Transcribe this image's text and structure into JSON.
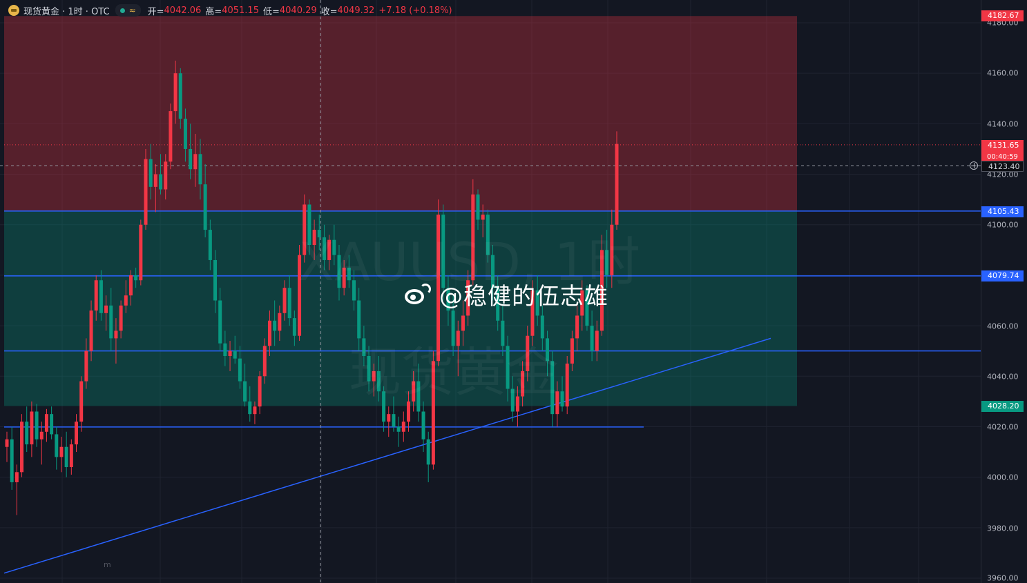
{
  "legend": {
    "title": "现货黄金 · 1时 · OTC",
    "wave_icon": "≈",
    "open_label": "开=",
    "open_value": "4042.06",
    "high_label": "高=",
    "high_value": "4051.15",
    "low_label": "低=",
    "low_value": "4040.29",
    "close_label": "收=",
    "close_value": "4049.32",
    "change": "+7.18 (+0.18%)"
  },
  "watermark": {
    "symbol_line": "XAUUSD, 1时",
    "name_line": "现货黄金",
    "author": "@稳健的伍志雄",
    "corner": "m"
  },
  "axis": {
    "ticks": [
      "4180.00",
      "4160.00",
      "4140.00",
      "4120.00",
      "4100.00",
      "4060.00",
      "4040.00",
      "4020.00",
      "4000.00",
      "3980.00",
      "3960.00"
    ],
    "tags": {
      "top": "4182.67",
      "last_price": "4131.65",
      "countdown": "00:40:59",
      "crosshair": "4123.40",
      "level_upper": "4105.43",
      "level_mid": "4079.74",
      "level_lower": "4028.20"
    }
  },
  "colors": {
    "up": "#f23645",
    "down": "#089981",
    "line": "#2962ff",
    "red_zone": "rgba(242,54,69,0.30)",
    "green_zone": "rgba(8,153,129,0.30)"
  },
  "chart_data": {
    "type": "candlestick",
    "y_range": [
      3960,
      4186
    ],
    "last_price": 4131.65,
    "crosshair_price": 4123.4,
    "zones": [
      {
        "kind": "short",
        "from": 4105.43,
        "to": 4182.67
      },
      {
        "kind": "long",
        "from": 4028.2,
        "to": 4105.43
      }
    ],
    "horizontal_levels": [
      4105.43,
      4079.74,
      4050.0,
      4019.9
    ],
    "trendline": {
      "from": 3962.0,
      "to": 4055.0
    },
    "series": [
      {
        "ohlc": [
          [
            4012,
            4018,
            4006,
            4015
          ],
          [
            4015,
            4020,
            3995,
            3998
          ],
          [
            3998,
            4005,
            3985,
            4002
          ],
          [
            4002,
            4025,
            4000,
            4022
          ],
          [
            4022,
            4028,
            4010,
            4013
          ],
          [
            4013,
            4030,
            4008,
            4026
          ],
          [
            4026,
            4029,
            4012,
            4015
          ],
          [
            4015,
            4022,
            4005,
            4018
          ],
          [
            4018,
            4027,
            4014,
            4025
          ],
          [
            4025,
            4028,
            4015,
            4017
          ],
          [
            4017,
            4020,
            4003,
            4008
          ],
          [
            4008,
            4016,
            4002,
            4012
          ],
          [
            4012,
            4018,
            4000,
            4004
          ],
          [
            4004,
            4015,
            4001,
            4013
          ],
          [
            4013,
            4025,
            4010,
            4022
          ],
          [
            4022,
            4040,
            4018,
            4038
          ],
          [
            4038,
            4055,
            4035,
            4050
          ],
          [
            4050,
            4070,
            4046,
            4066
          ],
          [
            4066,
            4080,
            4062,
            4078
          ],
          [
            4078,
            4082,
            4062,
            4065
          ],
          [
            4065,
            4072,
            4058,
            4068
          ],
          [
            4068,
            4075,
            4050,
            4055
          ],
          [
            4055,
            4063,
            4045,
            4058
          ],
          [
            4058,
            4070,
            4055,
            4068
          ],
          [
            4068,
            4078,
            4065,
            4072
          ],
          [
            4072,
            4082,
            4068,
            4080
          ],
          [
            4080,
            4083,
            4075,
            4078
          ],
          [
            4078,
            4102,
            4076,
            4100
          ],
          [
            4100,
            4130,
            4098,
            4126
          ],
          [
            4126,
            4132,
            4110,
            4115
          ],
          [
            4115,
            4124,
            4105,
            4120
          ],
          [
            4120,
            4128,
            4112,
            4114
          ],
          [
            4114,
            4128,
            4110,
            4125
          ],
          [
            4125,
            4148,
            4122,
            4145
          ],
          [
            4145,
            4165,
            4140,
            4160
          ],
          [
            4160,
            4162,
            4138,
            4142
          ],
          [
            4142,
            4146,
            4125,
            4130
          ],
          [
            4130,
            4140,
            4118,
            4122
          ],
          [
            4122,
            4136,
            4115,
            4128
          ],
          [
            4128,
            4134,
            4110,
            4116
          ],
          [
            4116,
            4124,
            4095,
            4098
          ],
          [
            4098,
            4102,
            4082,
            4086
          ],
          [
            4086,
            4090,
            4065,
            4070
          ],
          [
            4070,
            4075,
            4050,
            4053
          ],
          [
            4053,
            4058,
            4044,
            4048
          ],
          [
            4048,
            4054,
            4042,
            4050
          ],
          [
            4050,
            4056,
            4045,
            4047
          ],
          [
            4047,
            4052,
            4035,
            4038
          ],
          [
            4038,
            4045,
            4028,
            4030
          ],
          [
            4030,
            4036,
            4022,
            4025
          ],
          [
            4025,
            4030,
            4021,
            4028
          ],
          [
            4028,
            4042,
            4025,
            4040
          ],
          [
            4040,
            4055,
            4037,
            4052
          ],
          [
            4052,
            4066,
            4048,
            4062
          ],
          [
            4062,
            4070,
            4052,
            4058
          ],
          [
            4058,
            4068,
            4054,
            4065
          ],
          [
            4065,
            4078,
            4062,
            4075
          ],
          [
            4075,
            4080,
            4060,
            4063
          ],
          [
            4063,
            4066,
            4052,
            4056
          ],
          [
            4056,
            4092,
            4054,
            4088
          ],
          [
            4088,
            4112,
            4085,
            4108
          ],
          [
            4108,
            4110,
            4088,
            4092
          ],
          [
            4092,
            4102,
            4086,
            4098
          ],
          [
            4098,
            4104,
            4090,
            4095
          ],
          [
            4095,
            4100,
            4082,
            4086
          ],
          [
            4086,
            4096,
            4082,
            4094
          ],
          [
            4094,
            4100,
            4084,
            4088
          ],
          [
            4088,
            4092,
            4070,
            4075
          ],
          [
            4075,
            4086,
            4072,
            4083
          ],
          [
            4083,
            4088,
            4075,
            4078
          ],
          [
            4078,
            4082,
            4066,
            4070
          ],
          [
            4070,
            4075,
            4050,
            4055
          ],
          [
            4055,
            4060,
            4044,
            4048
          ],
          [
            4048,
            4052,
            4034,
            4038
          ],
          [
            4038,
            4045,
            4032,
            4042
          ],
          [
            4042,
            4048,
            4030,
            4034
          ],
          [
            4034,
            4036,
            4018,
            4022
          ],
          [
            4022,
            4028,
            4016,
            4025
          ],
          [
            4025,
            4032,
            4018,
            4020
          ],
          [
            4020,
            4024,
            4012,
            4018
          ],
          [
            4018,
            4026,
            4014,
            4022
          ],
          [
            4022,
            4034,
            4018,
            4030
          ],
          [
            4030,
            4042,
            4026,
            4038
          ],
          [
            4038,
            4045,
            4022,
            4026
          ],
          [
            4026,
            4030,
            4010,
            4015
          ],
          [
            4015,
            4018,
            3998,
            4005
          ],
          [
            4005,
            4050,
            4003,
            4046
          ],
          [
            4046,
            4110,
            4044,
            4104
          ],
          [
            4104,
            4108,
            4070,
            4075
          ],
          [
            4075,
            4080,
            4060,
            4066
          ],
          [
            4066,
            4072,
            4048,
            4052
          ],
          [
            4052,
            4062,
            4040,
            4058
          ],
          [
            4058,
            4070,
            4052,
            4064
          ],
          [
            4064,
            4082,
            4060,
            4078
          ],
          [
            4078,
            4118,
            4076,
            4112
          ],
          [
            4112,
            4114,
            4098,
            4102
          ],
          [
            4102,
            4108,
            4095,
            4104
          ],
          [
            4104,
            4106,
            4085,
            4088
          ],
          [
            4088,
            4092,
            4070,
            4075
          ],
          [
            4075,
            4080,
            4058,
            4062
          ],
          [
            4062,
            4068,
            4048,
            4052
          ],
          [
            4052,
            4056,
            4030,
            4035
          ],
          [
            4035,
            4040,
            4022,
            4026
          ],
          [
            4026,
            4036,
            4020,
            4032
          ],
          [
            4032,
            4046,
            4028,
            4042
          ],
          [
            4042,
            4060,
            4038,
            4056
          ],
          [
            4056,
            4078,
            4052,
            4074
          ],
          [
            4074,
            4080,
            4060,
            4064
          ],
          [
            4064,
            4068,
            4050,
            4055
          ],
          [
            4055,
            4058,
            4040,
            4046
          ],
          [
            4046,
            4050,
            4020,
            4025
          ],
          [
            4025,
            4038,
            4020,
            4034
          ],
          [
            4034,
            4040,
            4026,
            4028
          ],
          [
            4028,
            4048,
            4025,
            4045
          ],
          [
            4045,
            4058,
            4042,
            4055
          ],
          [
            4055,
            4068,
            4050,
            4064
          ],
          [
            4064,
            4078,
            4058,
            4074
          ],
          [
            4074,
            4076,
            4058,
            4060
          ],
          [
            4060,
            4066,
            4046,
            4050
          ],
          [
            4050,
            4062,
            4046,
            4058
          ],
          [
            4058,
            4096,
            4056,
            4090
          ],
          [
            4090,
            4098,
            4075,
            4080
          ],
          [
            4080,
            4106,
            4075,
            4100
          ],
          [
            4100,
            4137,
            4098,
            4132
          ]
        ]
      }
    ]
  }
}
